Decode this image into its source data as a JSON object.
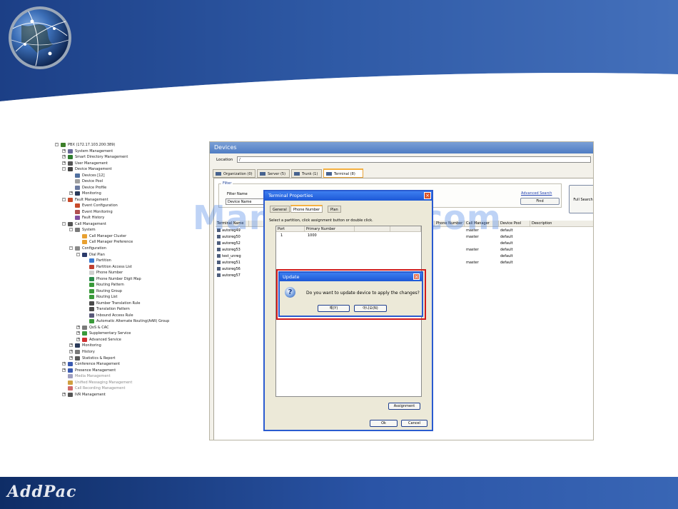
{
  "footer": {
    "logo_text": "AddPac"
  },
  "tree": [
    {
      "label": "PBX (172.17.103.200:389)",
      "level": 0,
      "box": "-",
      "color": "#3d7f2a"
    },
    {
      "label": "System Management",
      "level": 1,
      "box": "+",
      "color": "#6a6a9a"
    },
    {
      "label": "Smart Directory Management",
      "level": 1,
      "box": "+",
      "color": "#2f7d2f"
    },
    {
      "label": "User Management",
      "level": 1,
      "box": "+",
      "color": "#555555"
    },
    {
      "label": "Device Management",
      "level": 1,
      "box": "-",
      "color": "#444444"
    },
    {
      "label": "Devices  [12]",
      "level": 2,
      "box": "",
      "color": "#5070a0"
    },
    {
      "label": "Device Pool",
      "level": 2,
      "box": "",
      "color": "#a0a0a0"
    },
    {
      "label": "Device Profile",
      "level": 2,
      "box": "",
      "color": "#6a7aa0"
    },
    {
      "label": "Monitoring",
      "level": 2,
      "box": "+",
      "color": "#2a3a5a"
    },
    {
      "label": "Fault Management",
      "level": 1,
      "box": "-",
      "color": "#c84a2a"
    },
    {
      "label": "Event Configuration",
      "level": 2,
      "box": "",
      "color": "#c84a2a"
    },
    {
      "label": "Event Monitoring",
      "level": 2,
      "box": "",
      "color": "#b05050"
    },
    {
      "label": "Fault History",
      "level": 2,
      "box": "",
      "color": "#8050a0"
    },
    {
      "label": "Call Management",
      "level": 1,
      "box": "-",
      "color": "#555555"
    },
    {
      "label": "System",
      "level": 2,
      "box": "-",
      "color": "#7a7a7a"
    },
    {
      "label": "Call Manager Cluster",
      "level": 3,
      "box": "",
      "color": "#e8a030"
    },
    {
      "label": "Call Manager Preference",
      "level": 3,
      "box": "",
      "color": "#e8a030"
    },
    {
      "label": "Configuration",
      "level": 2,
      "box": "-",
      "color": "#8a8a8a"
    },
    {
      "label": "Dial Plan",
      "level": 3,
      "box": "-",
      "color": "#2a3a6a"
    },
    {
      "label": "Partition",
      "level": 4,
      "box": "",
      "color": "#3a7ad0"
    },
    {
      "label": "Partition Access List",
      "level": 4,
      "box": "",
      "color": "#c04030"
    },
    {
      "label": "Phone Number",
      "level": 4,
      "box": "",
      "color": "#d0d0d0"
    },
    {
      "label": "Phone Number Digit Map",
      "level": 4,
      "box": "",
      "color": "#2a8a4a"
    },
    {
      "label": "Routing Pattern",
      "level": 4,
      "box": "",
      "color": "#3a9a3a"
    },
    {
      "label": "Routing Group",
      "level": 4,
      "box": "",
      "color": "#3a9a3a"
    },
    {
      "label": "Routing List",
      "level": 4,
      "box": "",
      "color": "#3a9a3a"
    },
    {
      "label": "Number Translation Rule",
      "level": 4,
      "box": "",
      "color": "#4a4a4a"
    },
    {
      "label": "Translation Pattern",
      "level": 4,
      "box": "",
      "color": "#4a4a4a"
    },
    {
      "label": "Inbound Access Rule",
      "level": 4,
      "box": "",
      "color": "#5a5a7a"
    },
    {
      "label": "Automatic Alternate Routing(AAR) Group",
      "level": 4,
      "box": "",
      "color": "#3a9a3a"
    },
    {
      "label": "QoS & CAC",
      "level": 3,
      "box": "+",
      "color": "#7a7a7a"
    },
    {
      "label": "Supplementary Service",
      "level": 3,
      "box": "+",
      "color": "#3a9a3a"
    },
    {
      "label": "Advanced Service",
      "level": 3,
      "box": "+",
      "color": "#d03030"
    },
    {
      "label": "Monitoring",
      "level": 2,
      "box": "+",
      "color": "#2a3a5a"
    },
    {
      "label": "History",
      "level": 2,
      "box": "+",
      "color": "#7a7a7a"
    },
    {
      "label": "Statistics & Report",
      "level": 2,
      "box": "+",
      "color": "#5a5a5a"
    },
    {
      "label": "Conference Management",
      "level": 1,
      "box": "+",
      "color": "#3a5ab0"
    },
    {
      "label": "Presence Management",
      "level": 1,
      "box": "+",
      "color": "#3a5ab0"
    },
    {
      "label": "Media Management",
      "level": 1,
      "box": "",
      "color": "#a0a0c0",
      "disabled": true
    },
    {
      "label": "Unified Messaging Management",
      "level": 1,
      "box": "",
      "color": "#d0a040",
      "disabled": true
    },
    {
      "label": "Call Recording Management",
      "level": 1,
      "box": "",
      "color": "#d06a6a",
      "disabled": true
    },
    {
      "label": "IVR Management",
      "level": 1,
      "box": "+",
      "color": "#555555"
    }
  ],
  "devices": {
    "title": "Devices",
    "location_label": "Location",
    "location_value": "/",
    "tabs": [
      {
        "label": "Organization (0)",
        "active": false
      },
      {
        "label": "Server (5)",
        "active": false
      },
      {
        "label": "Trunk (1)",
        "active": false
      },
      {
        "label": "Terminal (8)",
        "active": true
      }
    ],
    "filter_legend": "Filter",
    "filter_name_label": "Filter Name",
    "filter_select_value": "Device Name",
    "advanced_search": "Advanced Search",
    "find_label": "Find",
    "full_search_label": "Full Search",
    "columns": [
      "Terminal Name",
      "",
      "",
      "",
      "",
      "",
      "Phone Number",
      "Call Manager",
      "Device Pool",
      "Description"
    ],
    "rows": [
      [
        "autoreg49",
        "",
        "master",
        "default"
      ],
      [
        "autoreg50",
        "",
        "master",
        "default"
      ],
      [
        "autoreg52",
        "",
        "",
        "default"
      ],
      [
        "autoreg53",
        "",
        "master",
        "default"
      ],
      [
        "test_unreg",
        "",
        "",
        "default"
      ],
      [
        "autoreg51",
        "",
        "master",
        "default"
      ],
      [
        "autoreg56",
        "",
        "",
        ""
      ],
      [
        "autoreg57",
        "",
        "",
        ""
      ]
    ]
  },
  "terminal_dialog": {
    "title": "Terminal Properties",
    "close_glyph": "×",
    "tabs": [
      "General",
      "Phone Number",
      "Plan"
    ],
    "instruction": "Select a partition, click assignment button or double click.",
    "list_columns": [
      "Port",
      "Primary Number",
      "",
      ""
    ],
    "list_rows": [
      [
        "1",
        "1000"
      ]
    ],
    "assignment_label": "Assignment",
    "ok_label": "Ok",
    "cancel_label": "Cancel"
  },
  "update_dialog": {
    "title": "Update",
    "close_glyph": "×",
    "icon_glyph": "?",
    "message": "Do you want to update device to apply the changes?",
    "yes_label": "예(Y)",
    "no_label": "아니오(N)"
  },
  "watermark": "ManualsLib.com"
}
